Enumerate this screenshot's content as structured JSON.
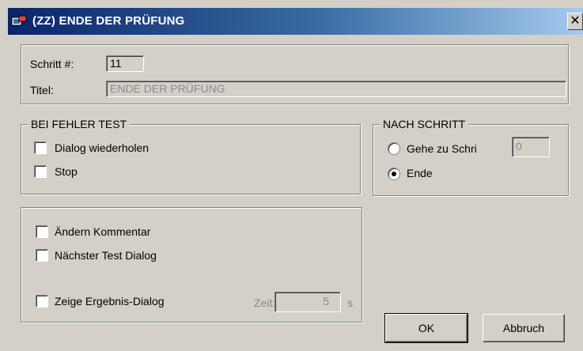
{
  "window": {
    "title": "(ZZ) ENDE DER PRÜFUNG",
    "close_glyph": "✕",
    "colors": {
      "titlebar_start": "#0a246a",
      "titlebar_end": "#a6caf0",
      "face": "#d4d0c8"
    }
  },
  "step": {
    "number_label": "Schritt #:",
    "number_value": "11",
    "title_label": "Titel:",
    "title_value": "ENDE DER PRÜFUNG"
  },
  "on_error": {
    "legend": "BEI FEHLER TEST",
    "options": [
      {
        "label": "Dialog wiederholen",
        "checked": false
      },
      {
        "label": "Stop",
        "checked": false
      }
    ]
  },
  "after_step": {
    "legend": "NACH SCHRITT",
    "goto_label": "Gehe zu Schri",
    "goto_value": "0",
    "end_label": "Ende",
    "selected": "Ende"
  },
  "extras": {
    "options": [
      {
        "label": "Ändern Kommentar",
        "checked": false
      },
      {
        "label": "Nächster Test Dialog",
        "checked": false
      },
      {
        "label": "Zeige Ergebnis-Dialog",
        "checked": false
      }
    ],
    "time_label": "Zeit:",
    "time_value": "5",
    "time_unit": "s"
  },
  "buttons": {
    "ok": "OK",
    "cancel": "Abbruch"
  }
}
